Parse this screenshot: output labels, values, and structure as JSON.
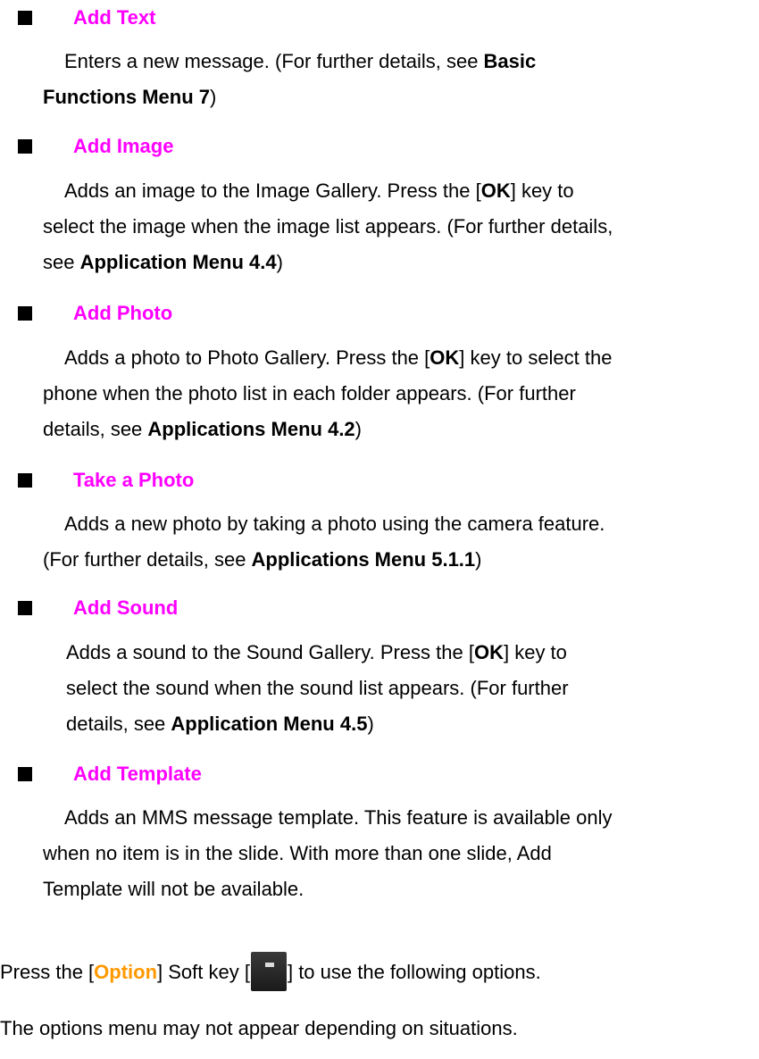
{
  "sections": [
    {
      "heading": "Add Text",
      "lines": [
        [
          "Enters a new message. (For further details, see ",
          {
            "b": "Basic"
          }
        ],
        [
          {
            "b": "Functions Menu 7"
          },
          ")"
        ]
      ]
    },
    {
      "heading": "Add Image",
      "lines": [
        [
          "Adds an image to the Image Gallery. Press the [",
          {
            "b": "OK"
          },
          "] key to"
        ],
        [
          "select the image when the image list appears. (For further details,"
        ],
        [
          "see ",
          {
            "b": "Application Menu 4.4"
          },
          ")"
        ]
      ]
    },
    {
      "heading": "Add Photo",
      "lines": [
        [
          "Adds a photo to Photo Gallery. Press the [",
          {
            "b": "OK"
          },
          "] key to select the"
        ],
        [
          "phone when the photo list in each folder appears. (For further"
        ],
        [
          "details, see ",
          {
            "b": "Applications Menu 4.2"
          },
          ")"
        ]
      ]
    },
    {
      "heading": "Take a Photo",
      "lines": [
        [
          "Adds a new photo by taking a photo using the camera feature."
        ],
        [
          "(For further details, see ",
          {
            "b": "Applications Menu 5.1.1"
          },
          ")"
        ]
      ]
    },
    {
      "heading": "Add Sound",
      "lines": [
        [
          "Adds a sound to the Sound Gallery. Press the [",
          {
            "b": "OK"
          },
          "] key to"
        ],
        [
          "select the sound when the sound list appears. (For further"
        ],
        [
          "details, see ",
          {
            "b": "Application Menu 4.5"
          },
          ")"
        ]
      ]
    },
    {
      "heading": "Add Template",
      "lines": [
        [
          "Adds an MMS message template. This feature is available only"
        ],
        [
          "when no item is in the slide. With more than one slide, Add"
        ],
        [
          "Template will not be available."
        ]
      ]
    }
  ],
  "footer": {
    "line1_pre": "Press the [",
    "line1_option": "Option",
    "line1_mid": "] Soft key [",
    "line1_post": "] to use the following options.",
    "softkey_icon": "minus-softkey-icon",
    "line2": "The options menu may not appear depending on situations."
  },
  "colors": {
    "heading": "#ff00ff",
    "option": "#ff9900",
    "bullet": "#000000"
  }
}
